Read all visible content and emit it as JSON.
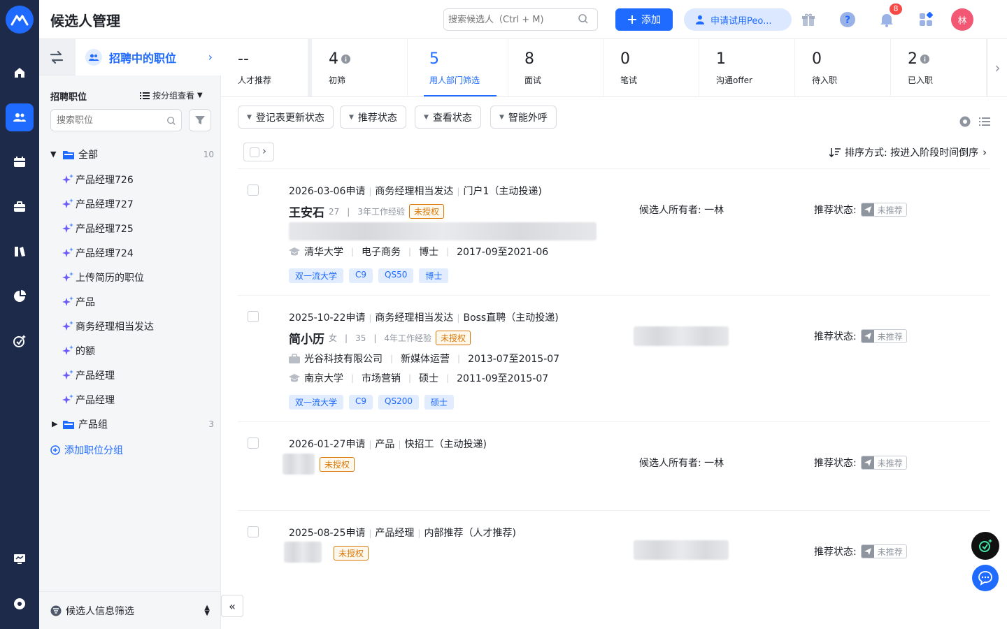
{
  "header": {
    "title": "候选人管理",
    "search_placeholder": "搜索候选人（Ctrl + M)",
    "add_label": "添加",
    "trial_label": "申请试用Peo...",
    "notif_count": "8",
    "avatar_text": "林"
  },
  "sidebar": {
    "current_job_label": "招聘中的职位",
    "section_title": "招聘职位",
    "group_view_label": "按分组查看",
    "search_placeholder": "搜索职位",
    "tree": {
      "all_label": "全部",
      "all_count": "10",
      "jobs": [
        "产品经理726",
        "产品经理727",
        "产品经理725",
        "产品经理724",
        "上传简历的职位",
        "产品",
        "商务经理相当发达",
        "的额",
        "产品经理",
        "产品经理"
      ],
      "group_label": "产品组",
      "group_count": "3"
    },
    "add_group_label": "添加职位分组",
    "footer_label": "候选人信息筛选"
  },
  "stages": [
    {
      "count": "--",
      "name": "人才推荐"
    },
    {
      "count": "4",
      "name": "初筛"
    },
    {
      "count": "5",
      "name": "用人部门筛选"
    },
    {
      "count": "8",
      "name": "面试"
    },
    {
      "count": "0",
      "name": "笔试"
    },
    {
      "count": "1",
      "name": "沟通offer"
    },
    {
      "count": "0",
      "name": "待入职"
    },
    {
      "count": "2",
      "name": "已入职"
    }
  ],
  "filters": {
    "registration": "登记表更新状态",
    "recommend": "推荐状态",
    "view": "查看状态",
    "call": "智能外呼"
  },
  "sort_label": "排序方式: 按进入阶段时间倒序",
  "labels": {
    "unauthorized": "未授权",
    "owner_prefix": "候选人所有者:",
    "rec_prefix": "推荐状态:",
    "not_recommended": "未推荐"
  },
  "candidates": [
    {
      "date": "2026-03-06申请",
      "job": "商务经理相当发达",
      "source": "门户1（主动投递)",
      "name": "王安石",
      "age": "27",
      "exp": "3年工作经验",
      "edu": {
        "school": "清华大学",
        "major": "电子商务",
        "degree": "博士",
        "period": "2017-09至2021-06"
      },
      "tags": [
        "双一流大学",
        "C9",
        "QS50",
        "博士"
      ],
      "owner": "一林"
    },
    {
      "date": "2025-10-22申请",
      "job": "商务经理相当发达",
      "source": "Boss直聘（主动投递)",
      "name": "简小历",
      "gender": "女",
      "age": "35",
      "exp": "4年工作经验",
      "work": {
        "company": "光谷科技有限公司",
        "role": "新媒体运营",
        "period": "2013-07至2015-07"
      },
      "edu": {
        "school": "南京大学",
        "major": "市场营销",
        "degree": "硕士",
        "period": "2011-09至2015-07"
      },
      "tags": [
        "双一流大学",
        "C9",
        "QS200",
        "硕士"
      ]
    },
    {
      "date": "2026-01-27申请",
      "job": "产品",
      "source": "快招工（主动投递)",
      "owner": "一林"
    },
    {
      "date": "2025-08-25申请",
      "job": "产品经理",
      "source": "内部推荐（人才推荐)"
    }
  ]
}
